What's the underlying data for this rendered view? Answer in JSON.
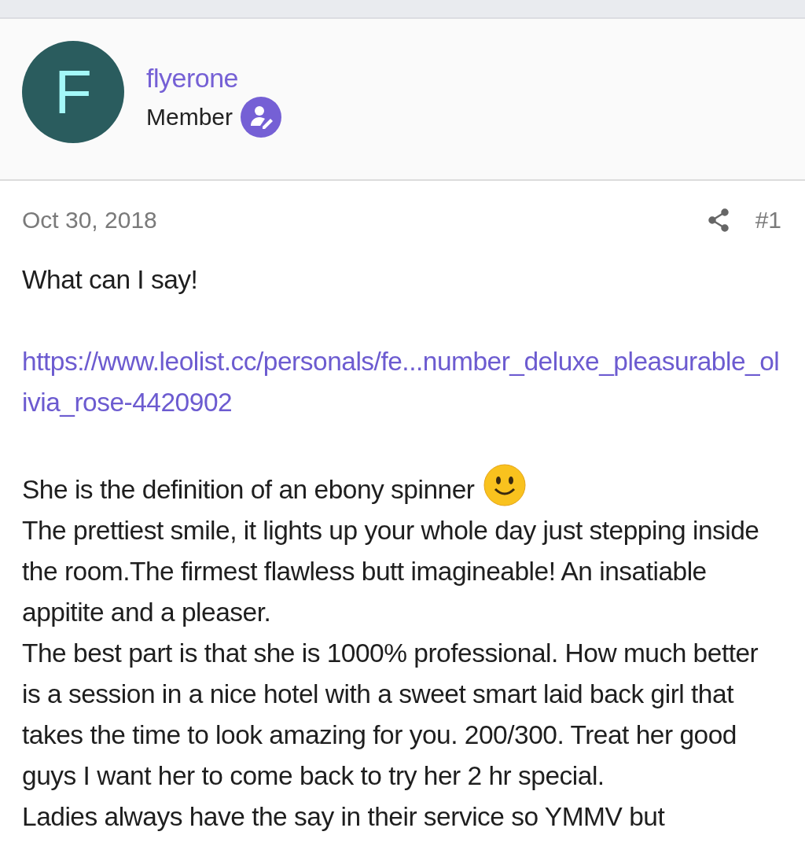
{
  "author": {
    "avatar_letter": "F",
    "username": "flyerone",
    "role": "Member"
  },
  "post": {
    "date": "Oct 30, 2018",
    "number": "#1",
    "paragraphs": [
      {
        "kind": "text",
        "text": "What can I say!"
      },
      {
        "kind": "link",
        "text": "https://www.leolist.cc/personals/fe...number_deluxe_pleasurable_olivia_rose-4420902"
      },
      {
        "kind": "text_with_smiley",
        "text": "She is the definition of an ebony spinner"
      },
      {
        "kind": "text",
        "text": "The prettiest smile, it lights up your whole day just stepping inside the room.The firmest flawless butt imagineable! An insatiable appitite and a pleaser."
      },
      {
        "kind": "text",
        "text": "The best part is that she is 1000% professional. How much better is a session in a nice hotel with a sweet smart laid back girl that takes the time to look amazing for you. 200/300. Treat her good guys I want her to come back to try her 2 hr special."
      },
      {
        "kind": "text",
        "text": "Ladies always have the say in their service so YMMV but"
      }
    ]
  }
}
